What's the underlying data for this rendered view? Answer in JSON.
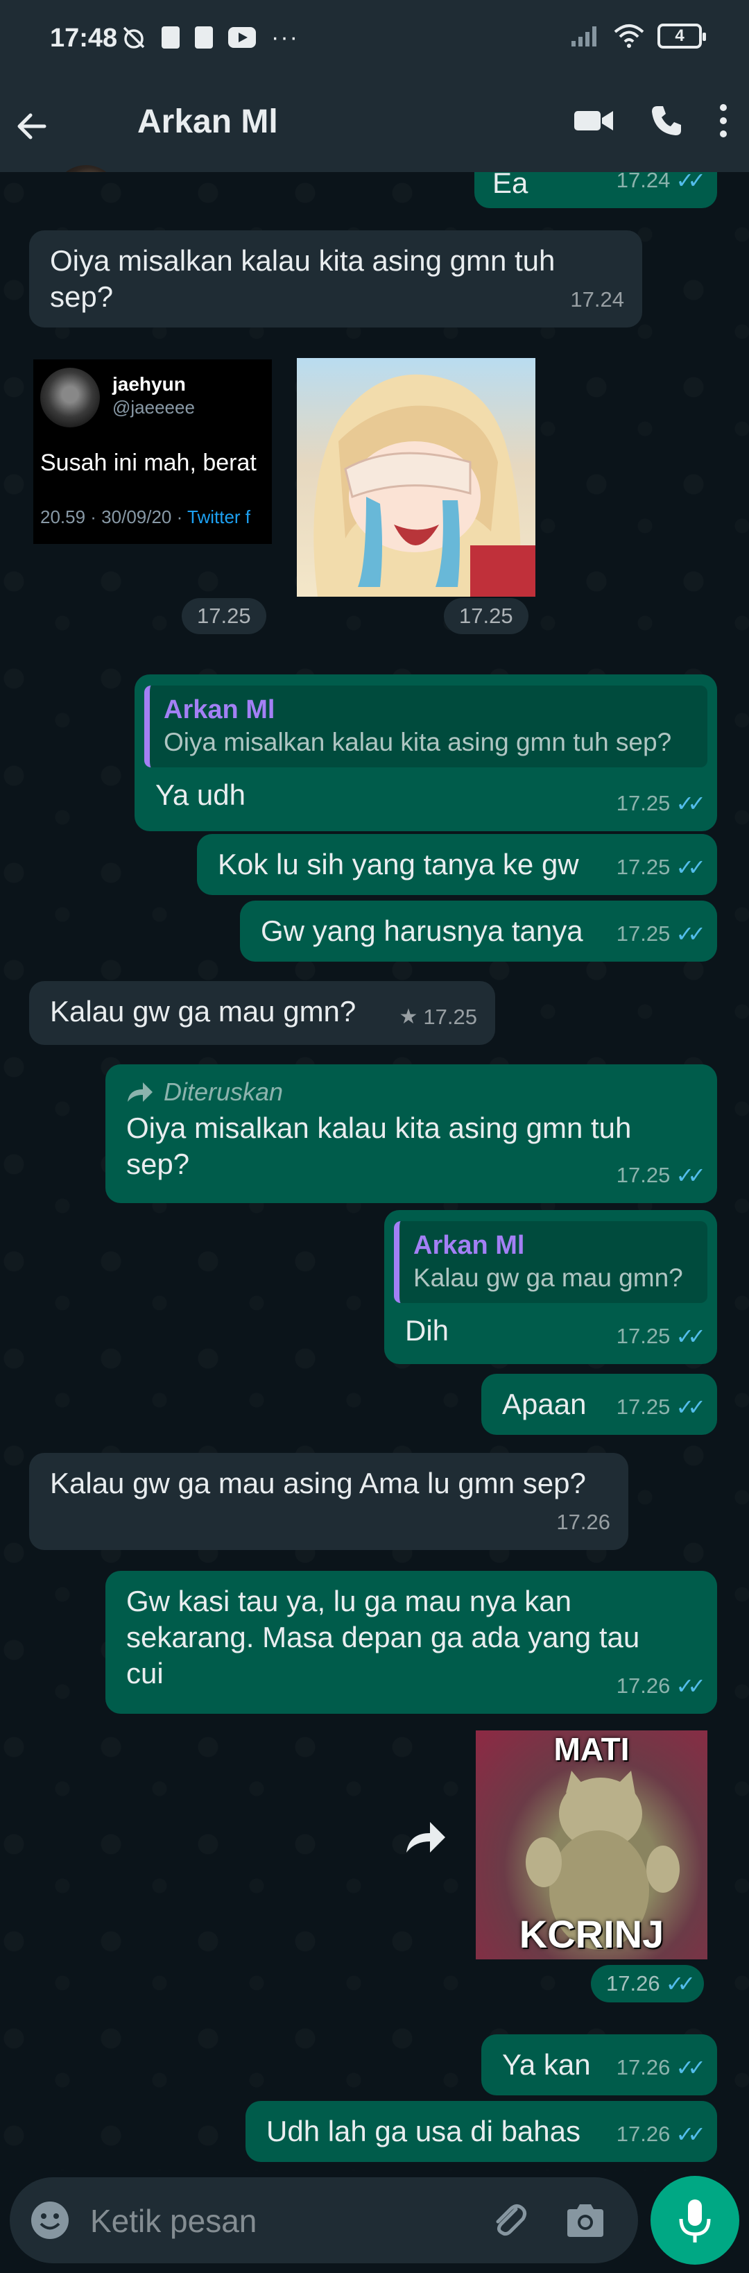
{
  "status_bar": {
    "time": "17:48",
    "battery": "4"
  },
  "header": {
    "contact_name": "Arkan Ml"
  },
  "messages": {
    "m0": {
      "text": "Ea",
      "time": "17.24"
    },
    "m1": {
      "text": "Oiya misalkan kalau kita asing gmn tuh sep?",
      "time": "17.24"
    },
    "tweet": {
      "name": "jaehyun",
      "handle": "@jaeeeee",
      "text": "Susah ini mah, berat",
      "date": "20.59 · 30/09/20 · ",
      "source": "Twitter f"
    },
    "img1_time": "17.25",
    "img2_time": "17.25",
    "m2": {
      "quote_name": "Arkan Ml",
      "quote_text": "Oiya misalkan kalau kita asing gmn tuh sep?",
      "text": "Ya udh",
      "time": "17.25"
    },
    "m3": {
      "text": "Kok lu sih yang tanya ke gw",
      "time": "17.25"
    },
    "m4": {
      "text": "Gw yang harusnya tanya",
      "time": "17.25"
    },
    "m5": {
      "text": "Kalau gw ga mau gmn?",
      "time": "17.25"
    },
    "m6": {
      "forwarded_label": "Diteruskan",
      "text": "Oiya misalkan kalau kita asing gmn tuh sep?",
      "time": "17.25"
    },
    "m7": {
      "quote_name": "Arkan Ml",
      "quote_text": "Kalau gw ga mau gmn?",
      "text": "Dih",
      "time": "17.25"
    },
    "m8": {
      "text": "Apaan",
      "time": "17.25"
    },
    "m9": {
      "text": "Kalau gw ga mau asing Ama lu gmn sep?",
      "time": "17.26"
    },
    "m10": {
      "text": "Gw kasi tau ya, lu ga mau nya kan sekarang. Masa depan ga ada yang tau cui",
      "time": "17.26"
    },
    "sticker": {
      "top_text": "MATI",
      "bottom_text": "KCRINJ",
      "time": "17.26"
    },
    "m11": {
      "text": "Ya kan",
      "time": "17.26"
    },
    "m12": {
      "text": "Udh lah ga usa di bahas",
      "time": "17.26"
    }
  },
  "input": {
    "placeholder": "Ketik pesan"
  },
  "colors": {
    "header_bg": "#1f2c34",
    "chat_bg": "#0b141a",
    "incoming": "#1f2c34",
    "outgoing": "#005c4b",
    "accent": "#00a884",
    "read_ticks": "#53bdeb",
    "quote_name": "#a380f5"
  }
}
